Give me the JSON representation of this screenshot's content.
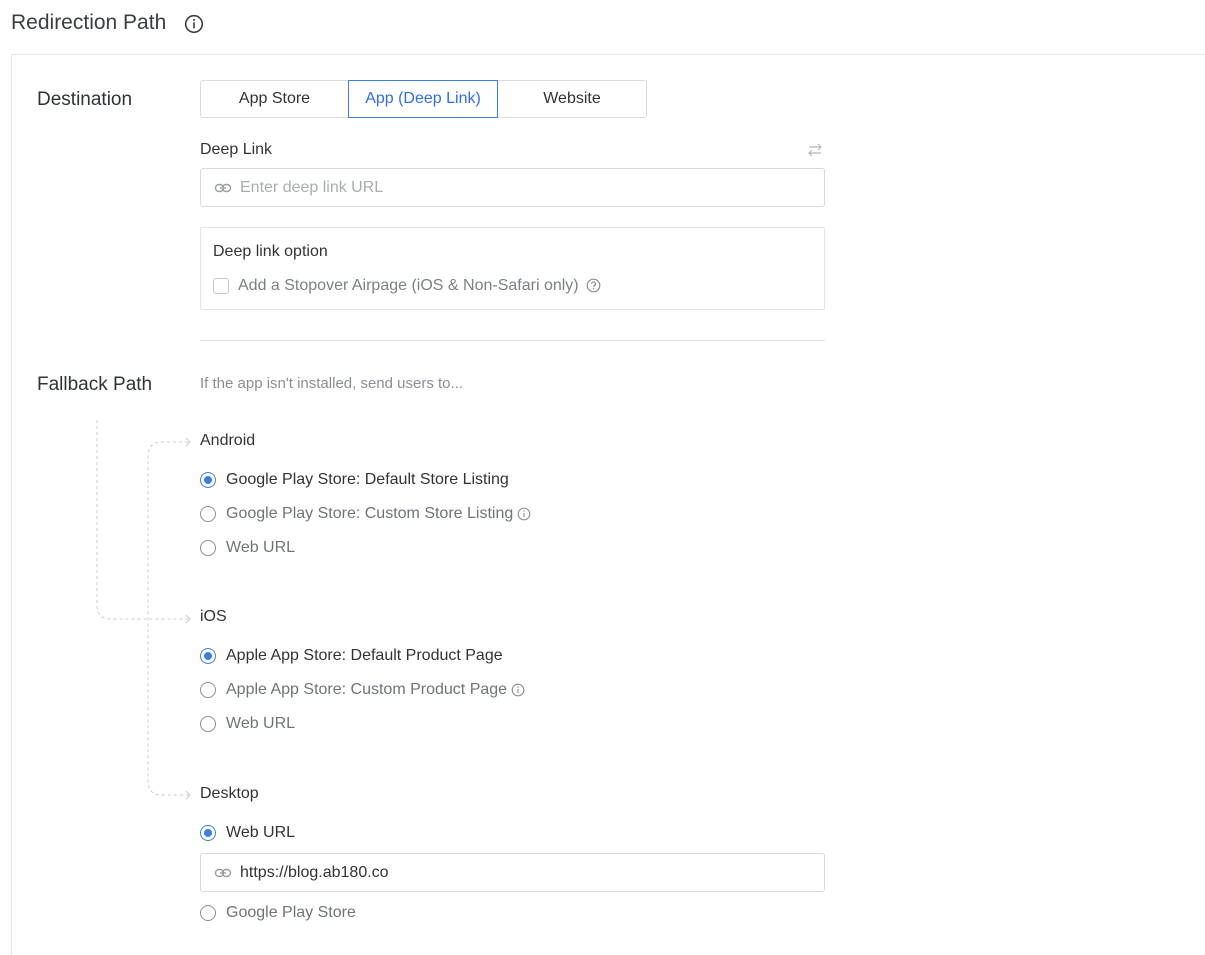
{
  "header": {
    "title": "Redirection Path"
  },
  "destination": {
    "label": "Destination",
    "tabs": [
      {
        "label": "App Store",
        "active": false
      },
      {
        "label": "App (Deep Link)",
        "active": true
      },
      {
        "label": "Website",
        "active": false
      }
    ],
    "deep_link": {
      "label": "Deep Link",
      "placeholder": "Enter deep link URL",
      "value": ""
    },
    "option": {
      "title": "Deep link option",
      "checkbox_label": "Add a Stopover Airpage (iOS & Non-Safari only)",
      "checked": false
    }
  },
  "fallback": {
    "label": "Fallback Path",
    "hint": "If the app isn't installed, send users to...",
    "android": {
      "title": "Android",
      "options": [
        {
          "label": "Google Play Store: Default Store Listing",
          "checked": true
        },
        {
          "label": "Google Play Store: Custom Store Listing",
          "checked": false
        },
        {
          "label": "Web URL",
          "checked": false
        }
      ]
    },
    "ios": {
      "title": "iOS",
      "options": [
        {
          "label": "Apple App Store: Default Product Page",
          "checked": true
        },
        {
          "label": "Apple App Store: Custom Product Page",
          "checked": false
        },
        {
          "label": "Web URL",
          "checked": false
        }
      ]
    },
    "desktop": {
      "title": "Desktop",
      "options": [
        {
          "label": "Web URL",
          "checked": true
        },
        {
          "label": "Google Play Store",
          "checked": false
        }
      ],
      "web_url_value": "https://blog.ab180.co"
    }
  },
  "colors": {
    "accent": "#3b7ee8",
    "border": "#d9d9d9",
    "muted_text": "#7c8087"
  }
}
